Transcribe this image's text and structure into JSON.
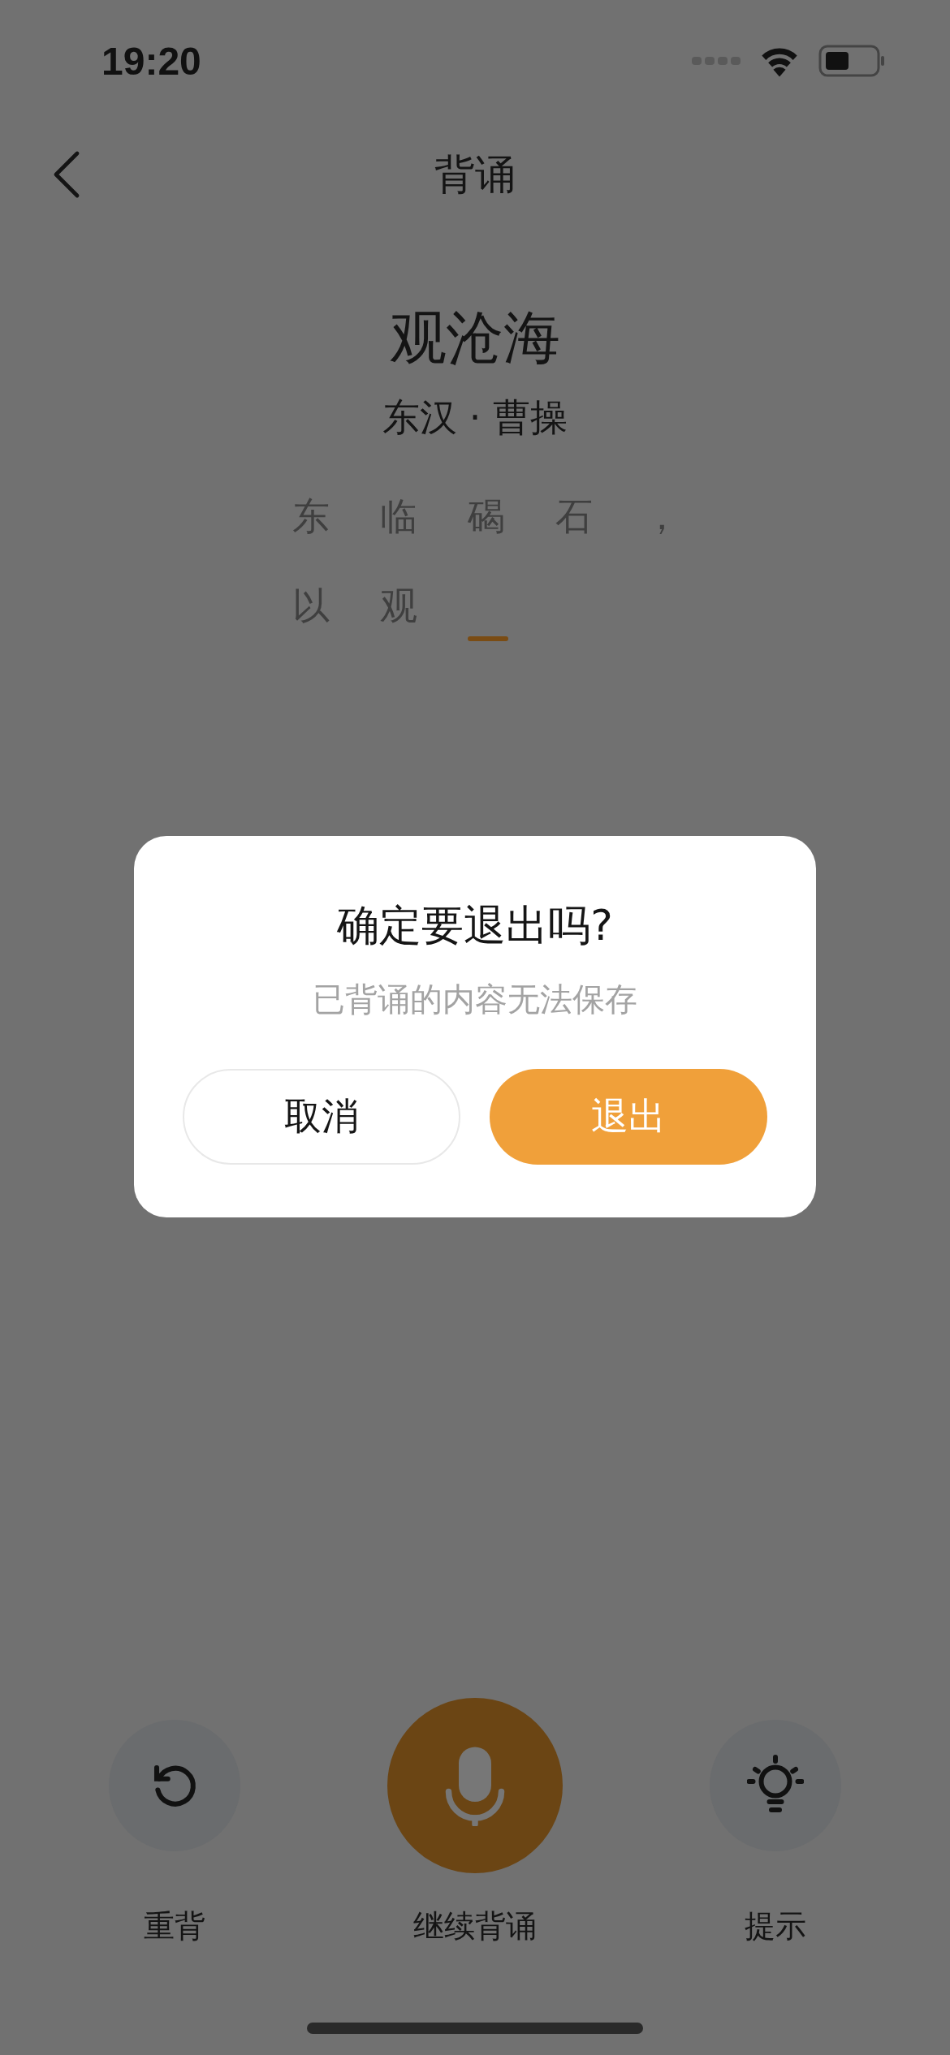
{
  "status_bar": {
    "time": "19:20"
  },
  "nav": {
    "title": "背诵"
  },
  "poem": {
    "title": "观沧海",
    "author": "东汉 · 曹操",
    "lines": [
      {
        "chars": [
          "东",
          "临",
          "碣",
          "石",
          "，"
        ],
        "cursor": false
      },
      {
        "chars": [
          "以",
          "观"
        ],
        "cursor": true
      }
    ]
  },
  "dialog": {
    "title": "确定要退出吗?",
    "message": "已背诵的内容无法保存",
    "buttons": [
      {
        "label": "取消",
        "kind": "secondary"
      },
      {
        "label": "退出",
        "kind": "primary"
      }
    ]
  },
  "actions": [
    {
      "label": "重背",
      "kind": "restart"
    },
    {
      "label": "继续背诵",
      "kind": "record"
    },
    {
      "label": "提示",
      "kind": "hint"
    }
  ]
}
